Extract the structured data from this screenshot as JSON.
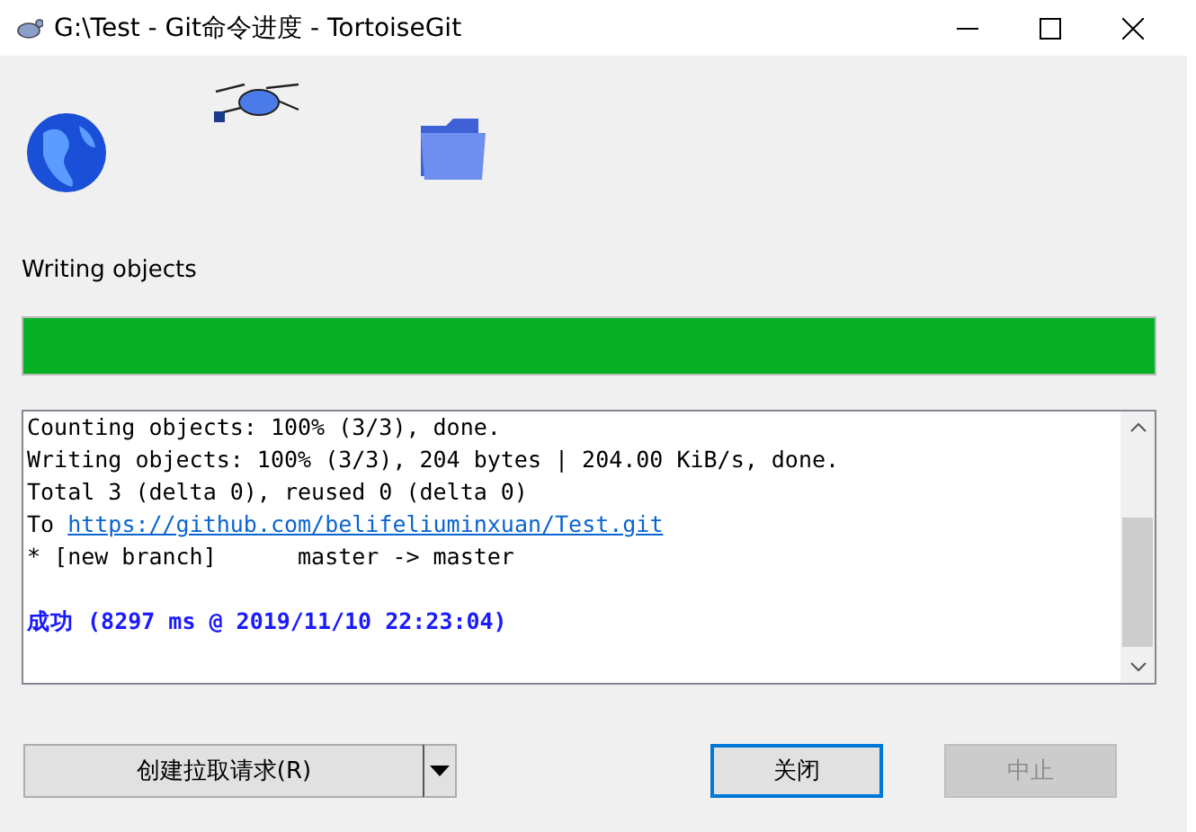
{
  "window": {
    "title": "G:\\Test - Git命令进度 - TortoiseGit"
  },
  "status_label": "Writing objects",
  "progress": {
    "level": 1.0
  },
  "log": [
    {
      "kind": "text",
      "text": "Counting objects: 100% (3/3), done."
    },
    {
      "kind": "text",
      "text": "Writing objects: 100% (3/3), 204 bytes | 204.00 KiB/s, done."
    },
    {
      "kind": "text",
      "text": "Total 3 (delta 0), reused 0 (delta 0)"
    },
    {
      "kind": "link",
      "prefix": "To",
      "url": "https://github.com/belifeliuminxuan/Test.git"
    },
    {
      "kind": "text",
      "text": "* [new branch]      master -> master"
    },
    {
      "kind": "blank"
    },
    {
      "kind": "success",
      "text": "成功 (8297 ms @ 2019/11/10 22:23:04)"
    }
  ],
  "buttons": [
    {
      "kind": "split",
      "label": "创建拉取请求(R)",
      "disabled": false,
      "default": false
    },
    {
      "kind": "plain",
      "label": "关闭",
      "disabled": false,
      "default": true
    },
    {
      "kind": "plain",
      "label": "中止",
      "disabled": true,
      "default": false
    }
  ]
}
